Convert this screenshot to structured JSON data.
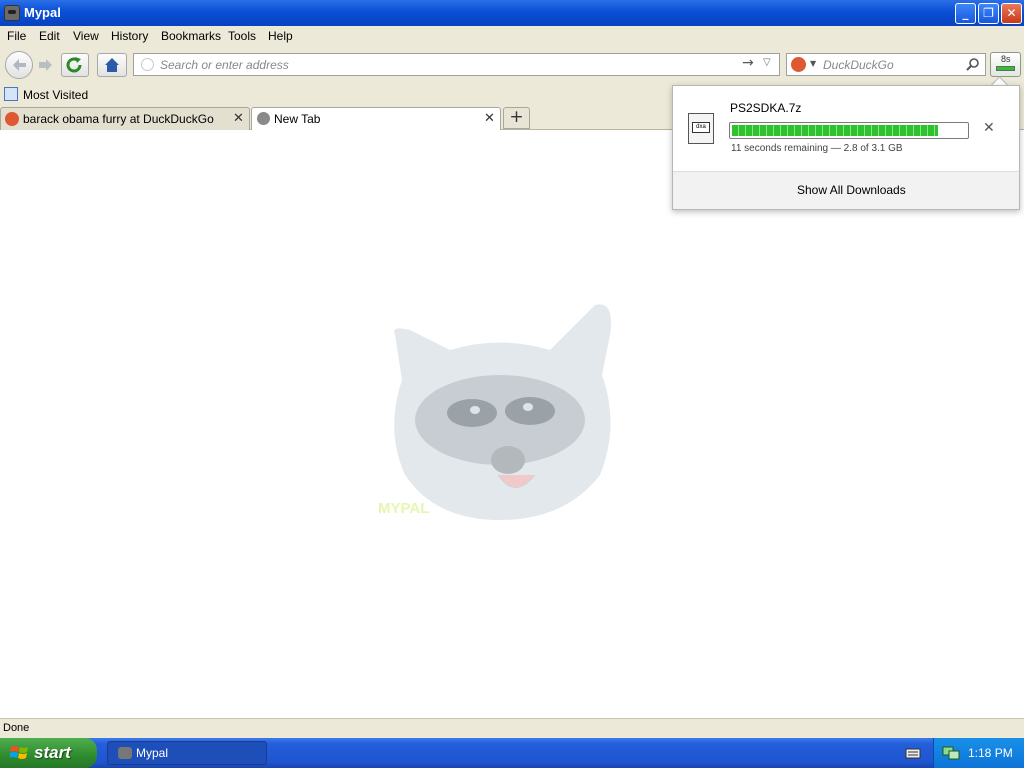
{
  "window": {
    "title": "Mypal"
  },
  "menu": [
    "File",
    "Edit",
    "View",
    "History",
    "Bookmarks",
    "Tools",
    "Help"
  ],
  "navbar": {
    "url_placeholder": "Search or enter address",
    "search_placeholder": "DuckDuckGo",
    "download_button_label": "8s"
  },
  "bookmarks": {
    "most_visited": "Most Visited"
  },
  "tabs": [
    {
      "label": "barack obama furry at DuckDuckGo"
    },
    {
      "label": "New Tab"
    }
  ],
  "content": {
    "logo_text": "MYPAL"
  },
  "downloads": {
    "filename": "PS2SDKA.7z",
    "file_icon_label": "dxa",
    "progress_fraction": 0.88,
    "status": "11 seconds remaining — 2.8 of 3.1 GB",
    "show_all": "Show All Downloads"
  },
  "statusbar": {
    "text": "Done"
  },
  "taskbar": {
    "start": "start",
    "task": "Mypal",
    "clock": "1:18 PM"
  },
  "colors": {
    "title_blue": "#0a4fd6",
    "progress_green": "#2ec22e",
    "start_green": "#2e8b2e"
  }
}
